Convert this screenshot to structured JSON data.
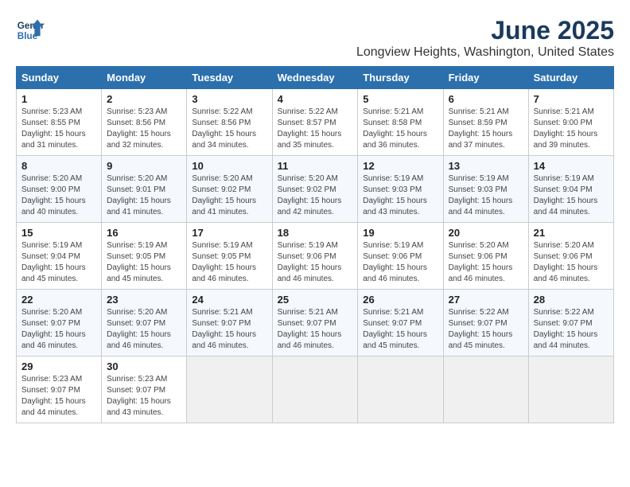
{
  "logo": {
    "line1": "General",
    "line2": "Blue"
  },
  "title": "June 2025",
  "subtitle": "Longview Heights, Washington, United States",
  "days_of_week": [
    "Sunday",
    "Monday",
    "Tuesday",
    "Wednesday",
    "Thursday",
    "Friday",
    "Saturday"
  ],
  "weeks": [
    [
      {
        "day": "1",
        "sunrise": "5:23 AM",
        "sunset": "8:55 PM",
        "daylight": "15 hours and 31 minutes."
      },
      {
        "day": "2",
        "sunrise": "5:23 AM",
        "sunset": "8:56 PM",
        "daylight": "15 hours and 32 minutes."
      },
      {
        "day": "3",
        "sunrise": "5:22 AM",
        "sunset": "8:56 PM",
        "daylight": "15 hours and 34 minutes."
      },
      {
        "day": "4",
        "sunrise": "5:22 AM",
        "sunset": "8:57 PM",
        "daylight": "15 hours and 35 minutes."
      },
      {
        "day": "5",
        "sunrise": "5:21 AM",
        "sunset": "8:58 PM",
        "daylight": "15 hours and 36 minutes."
      },
      {
        "day": "6",
        "sunrise": "5:21 AM",
        "sunset": "8:59 PM",
        "daylight": "15 hours and 37 minutes."
      },
      {
        "day": "7",
        "sunrise": "5:21 AM",
        "sunset": "9:00 PM",
        "daylight": "15 hours and 39 minutes."
      }
    ],
    [
      {
        "day": "8",
        "sunrise": "5:20 AM",
        "sunset": "9:00 PM",
        "daylight": "15 hours and 40 minutes."
      },
      {
        "day": "9",
        "sunrise": "5:20 AM",
        "sunset": "9:01 PM",
        "daylight": "15 hours and 41 minutes."
      },
      {
        "day": "10",
        "sunrise": "5:20 AM",
        "sunset": "9:02 PM",
        "daylight": "15 hours and 41 minutes."
      },
      {
        "day": "11",
        "sunrise": "5:20 AM",
        "sunset": "9:02 PM",
        "daylight": "15 hours and 42 minutes."
      },
      {
        "day": "12",
        "sunrise": "5:19 AM",
        "sunset": "9:03 PM",
        "daylight": "15 hours and 43 minutes."
      },
      {
        "day": "13",
        "sunrise": "5:19 AM",
        "sunset": "9:03 PM",
        "daylight": "15 hours and 44 minutes."
      },
      {
        "day": "14",
        "sunrise": "5:19 AM",
        "sunset": "9:04 PM",
        "daylight": "15 hours and 44 minutes."
      }
    ],
    [
      {
        "day": "15",
        "sunrise": "5:19 AM",
        "sunset": "9:04 PM",
        "daylight": "15 hours and 45 minutes."
      },
      {
        "day": "16",
        "sunrise": "5:19 AM",
        "sunset": "9:05 PM",
        "daylight": "15 hours and 45 minutes."
      },
      {
        "day": "17",
        "sunrise": "5:19 AM",
        "sunset": "9:05 PM",
        "daylight": "15 hours and 46 minutes."
      },
      {
        "day": "18",
        "sunrise": "5:19 AM",
        "sunset": "9:06 PM",
        "daylight": "15 hours and 46 minutes."
      },
      {
        "day": "19",
        "sunrise": "5:19 AM",
        "sunset": "9:06 PM",
        "daylight": "15 hours and 46 minutes."
      },
      {
        "day": "20",
        "sunrise": "5:20 AM",
        "sunset": "9:06 PM",
        "daylight": "15 hours and 46 minutes."
      },
      {
        "day": "21",
        "sunrise": "5:20 AM",
        "sunset": "9:06 PM",
        "daylight": "15 hours and 46 minutes."
      }
    ],
    [
      {
        "day": "22",
        "sunrise": "5:20 AM",
        "sunset": "9:07 PM",
        "daylight": "15 hours and 46 minutes."
      },
      {
        "day": "23",
        "sunrise": "5:20 AM",
        "sunset": "9:07 PM",
        "daylight": "15 hours and 46 minutes."
      },
      {
        "day": "24",
        "sunrise": "5:21 AM",
        "sunset": "9:07 PM",
        "daylight": "15 hours and 46 minutes."
      },
      {
        "day": "25",
        "sunrise": "5:21 AM",
        "sunset": "9:07 PM",
        "daylight": "15 hours and 46 minutes."
      },
      {
        "day": "26",
        "sunrise": "5:21 AM",
        "sunset": "9:07 PM",
        "daylight": "15 hours and 45 minutes."
      },
      {
        "day": "27",
        "sunrise": "5:22 AM",
        "sunset": "9:07 PM",
        "daylight": "15 hours and 45 minutes."
      },
      {
        "day": "28",
        "sunrise": "5:22 AM",
        "sunset": "9:07 PM",
        "daylight": "15 hours and 44 minutes."
      }
    ],
    [
      {
        "day": "29",
        "sunrise": "5:23 AM",
        "sunset": "9:07 PM",
        "daylight": "15 hours and 44 minutes."
      },
      {
        "day": "30",
        "sunrise": "5:23 AM",
        "sunset": "9:07 PM",
        "daylight": "15 hours and 43 minutes."
      },
      null,
      null,
      null,
      null,
      null
    ]
  ],
  "labels": {
    "sunrise": "Sunrise: ",
    "sunset": "Sunset: ",
    "daylight": "Daylight: "
  }
}
